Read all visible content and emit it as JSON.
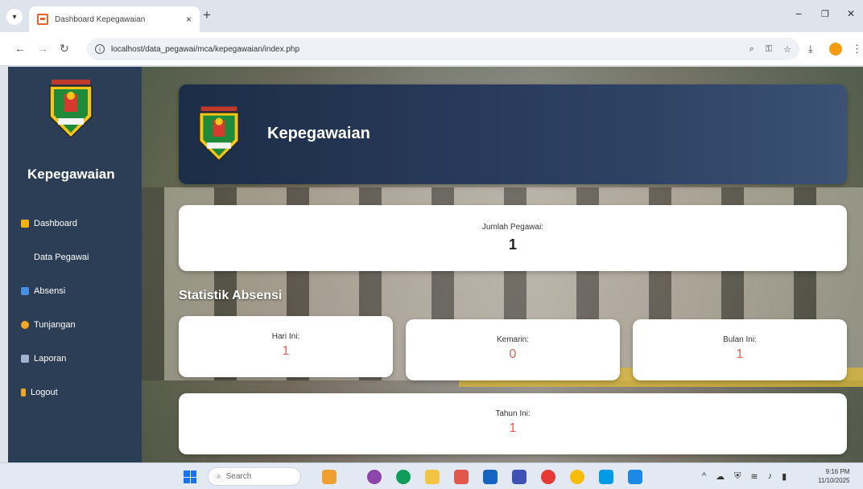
{
  "browser": {
    "tab_title": "Dashboard Kepegawaian",
    "close_glyph": "×",
    "new_tab_glyph": "+",
    "url": "localhost/data_pegawai/mca/kepegawaian/index.php",
    "window_controls": {
      "minimize": "−",
      "restore": "❐",
      "close": "✕"
    }
  },
  "sidebar": {
    "brand": "Kepegawaian",
    "menu": [
      {
        "label": "Dashboard",
        "icon": "home-icon",
        "color": "#f4b400"
      },
      {
        "label": "Data Pegawai",
        "icon": "users-icon",
        "color": "#2c3e55"
      },
      {
        "label": "Absensi",
        "icon": "calendar-icon",
        "color": "#4a90e2"
      },
      {
        "label": "Tunjangan",
        "icon": "money-bag-icon",
        "color": "#f5a623"
      },
      {
        "label": "Laporan",
        "icon": "report-icon",
        "color": "#9fb3d1"
      },
      {
        "label": "Logout",
        "icon": "door-icon",
        "color": "#f5a623"
      }
    ]
  },
  "header": {
    "title": "Kepegawaian"
  },
  "summary": {
    "label": "Jumlah Pegawai:",
    "value": "1"
  },
  "stats": {
    "title": "Statistik Absensi",
    "today": {
      "label": "Hari Ini:",
      "value": "1"
    },
    "yesterday": {
      "label": "Kemarin:",
      "value": "0"
    },
    "month": {
      "label": "Bulan Ini:",
      "value": "1"
    },
    "year": {
      "label": "Tahun Ini:",
      "value": "1"
    }
  },
  "taskbar": {
    "search_placeholder": "Search",
    "clock_time": "9:16 PM",
    "clock_date": "11/10/2025"
  },
  "colors": {
    "sidebar_bg": "#2c3e55",
    "header_bg": "#1c2d47",
    "value_red": "#e0645a"
  }
}
